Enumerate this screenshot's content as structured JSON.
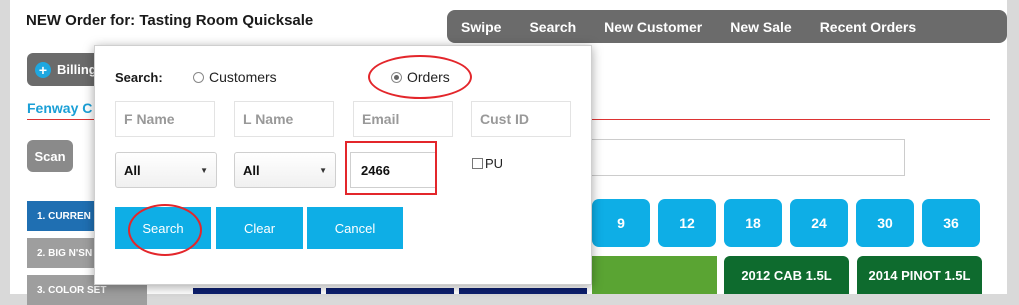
{
  "page_title": "NEW Order for: Tasting Room Quicksale",
  "topnav": [
    "Swipe",
    "Search",
    "New Customer",
    "New Sale",
    "Recent Orders"
  ],
  "billing_label": "Billing",
  "account_name": "Fenway C",
  "scan_label": "Scan",
  "side_tabs": [
    "1. CURREN",
    "2. BIG N'SN",
    "3. COLOR SET"
  ],
  "quantity_buttons": [
    "9",
    "12",
    "18",
    "24",
    "30",
    "36"
  ],
  "product_tiles": [
    "2012 CAB 1.5L",
    "2014 PINOT 1.5L"
  ],
  "search_popup": {
    "search_label": "Search:",
    "options": [
      "Customers",
      "Orders"
    ],
    "selected_option": "Orders",
    "fields": {
      "first_name_placeholder": "F Name",
      "last_name_placeholder": "L Name",
      "email_placeholder": "Email",
      "cust_id_placeholder": "Cust ID"
    },
    "select1_value": "All",
    "select2_value": "All",
    "email_value": "2466",
    "pu_label": "PU",
    "buttons": {
      "search": "Search",
      "clear": "Clear",
      "cancel": "Cancel"
    }
  },
  "colors": {
    "accent": "#0eaee6",
    "nav_bg": "#6b6b6b",
    "annotation_red": "#e3262b",
    "product_green": "#0e6b2e"
  }
}
